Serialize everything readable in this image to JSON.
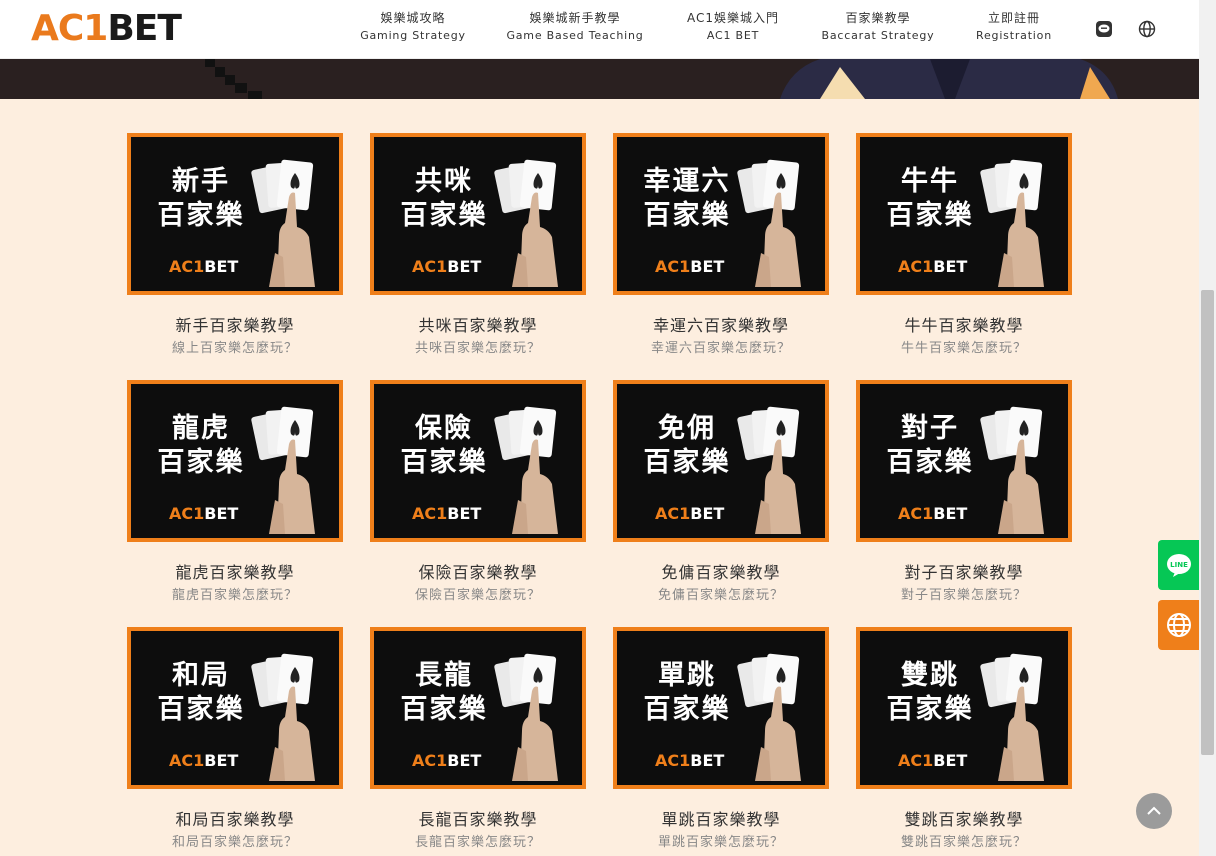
{
  "brand": {
    "logo_ac": "AC",
    "logo_one": "1",
    "logo_bet": "BET"
  },
  "nav": [
    {
      "zh": "娛樂城攻略",
      "en": "Gaming Strategy"
    },
    {
      "zh": "娛樂城新手教學",
      "en": "Game Based Teaching"
    },
    {
      "zh": "AC1娛樂城入門",
      "en": "AC1 BET"
    },
    {
      "zh": "百家樂教學",
      "en": "Baccarat Strategy"
    },
    {
      "zh": "立即註冊",
      "en": "Registration"
    }
  ],
  "header_icons": [
    "line-icon",
    "globe-icon"
  ],
  "cards": [
    {
      "line1": "新手",
      "line2": "百家樂",
      "title": "新手百家樂教學",
      "sub": "線上百家樂怎麼玩？"
    },
    {
      "line1": "共咪",
      "line2": "百家樂",
      "title": "共咪百家樂教學",
      "sub": "共咪百家樂怎麼玩？"
    },
    {
      "line1": "幸運六",
      "line2": "百家樂",
      "title": "幸運六百家樂教學",
      "sub": "幸運六百家樂怎麼玩？"
    },
    {
      "line1": "牛牛",
      "line2": "百家樂",
      "title": "牛牛百家樂教學",
      "sub": "牛牛百家樂怎麼玩？"
    },
    {
      "line1": "龍虎",
      "line2": "百家樂",
      "title": "龍虎百家樂教學",
      "sub": "龍虎百家樂怎麼玩？"
    },
    {
      "line1": "保險",
      "line2": "百家樂",
      "title": "保險百家樂教學",
      "sub": "保險百家樂怎麼玩？"
    },
    {
      "line1": "免佣",
      "line2": "百家樂",
      "title": "免傭百家樂教學",
      "sub": "免傭百家樂怎麼玩？"
    },
    {
      "line1": "對子",
      "line2": "百家樂",
      "title": "對子百家樂教學",
      "sub": "對子百家樂怎麼玩？"
    },
    {
      "line1": "和局",
      "line2": "百家樂",
      "title": "和局百家樂教學",
      "sub": "和局百家樂怎麼玩？"
    },
    {
      "line1": "長龍",
      "line2": "百家樂",
      "title": "長龍百家樂教學",
      "sub": "長龍百家樂怎麼玩？"
    },
    {
      "line1": "單跳",
      "line2": "百家樂",
      "title": "單跳百家樂教學",
      "sub": "單跳百家樂怎麼玩？"
    },
    {
      "line1": "雙跳",
      "line2": "百家樂",
      "title": "雙跳百家樂教學",
      "sub": "雙跳百家樂怎麼玩？"
    }
  ],
  "thumb_logo": {
    "a": "AC1",
    "b": "BET"
  },
  "colors": {
    "accent": "#ef7f1a",
    "line_green": "#06c755",
    "page_bg": "#fdeedf"
  }
}
